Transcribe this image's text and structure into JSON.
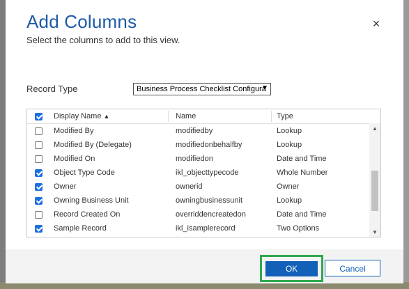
{
  "dialog": {
    "title": "Add Columns",
    "subtitle": "Select the columns to add to this view.",
    "close_icon": "×"
  },
  "record_type": {
    "label": "Record Type",
    "selected": "Business Process Checklist Configura"
  },
  "grid": {
    "columns": {
      "display_name": "Display Name",
      "sort_icon": "▲",
      "name": "Name",
      "type": "Type"
    },
    "rows": [
      {
        "checked": false,
        "display": "Modified By",
        "name": "modifiedby",
        "type": "Lookup"
      },
      {
        "checked": false,
        "display": "Modified By (Delegate)",
        "name": "modifiedonbehalfby",
        "type": "Lookup"
      },
      {
        "checked": false,
        "display": "Modified On",
        "name": "modifiedon",
        "type": "Date and Time"
      },
      {
        "checked": true,
        "display": "Object Type Code",
        "name": "ikl_objecttypecode",
        "type": "Whole Number"
      },
      {
        "checked": true,
        "display": "Owner",
        "name": "ownerid",
        "type": "Owner"
      },
      {
        "checked": true,
        "display": "Owning Business Unit",
        "name": "owningbusinessunit",
        "type": "Lookup"
      },
      {
        "checked": false,
        "display": "Record Created On",
        "name": "overriddencreatedon",
        "type": "Date and Time"
      },
      {
        "checked": true,
        "display": "Sample Record",
        "name": "ikl_isamplerecord",
        "type": "Two Options"
      }
    ]
  },
  "footer": {
    "ok_label": "OK",
    "cancel_label": "Cancel"
  }
}
